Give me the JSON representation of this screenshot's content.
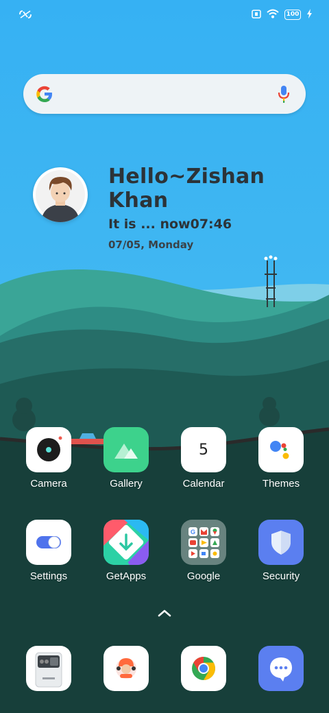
{
  "status_bar": {
    "battery_level": "100",
    "left_icon": "nfc-off-icon",
    "right_icons": [
      "sim-card-icon",
      "wifi-icon",
      "battery-icon",
      "charging-bolt-icon"
    ]
  },
  "search_bar": {
    "logo_icon": "google-g-icon",
    "mic_icon": "microphone-icon"
  },
  "greeting": {
    "headline": "Hello~Zishan Khan",
    "time_line": "It is ... now07:46",
    "date_line": "07/05, Monday"
  },
  "apps_row1": [
    {
      "label": "Camera",
      "icon": "camera-icon"
    },
    {
      "label": "Gallery",
      "icon": "gallery-icon"
    },
    {
      "label": "Calendar",
      "icon": "calendar-icon",
      "day": "5"
    },
    {
      "label": "Themes",
      "icon": "themes-icon"
    }
  ],
  "apps_row2": [
    {
      "label": "Settings",
      "icon": "settings-toggle-icon"
    },
    {
      "label": "GetApps",
      "icon": "getapps-icon"
    },
    {
      "label": "Google",
      "icon": "google-folder-icon"
    },
    {
      "label": "Security",
      "icon": "shield-icon"
    }
  ],
  "dock": [
    {
      "icon": "phone-widget-icon"
    },
    {
      "icon": "contacts-icon"
    },
    {
      "icon": "chrome-icon"
    },
    {
      "icon": "messages-icon"
    }
  ],
  "colors": {
    "sky": "#3ab3f2",
    "hill_light": "#3aa597",
    "hill_dark": "#173f3a",
    "text_dark": "#2c3338"
  }
}
